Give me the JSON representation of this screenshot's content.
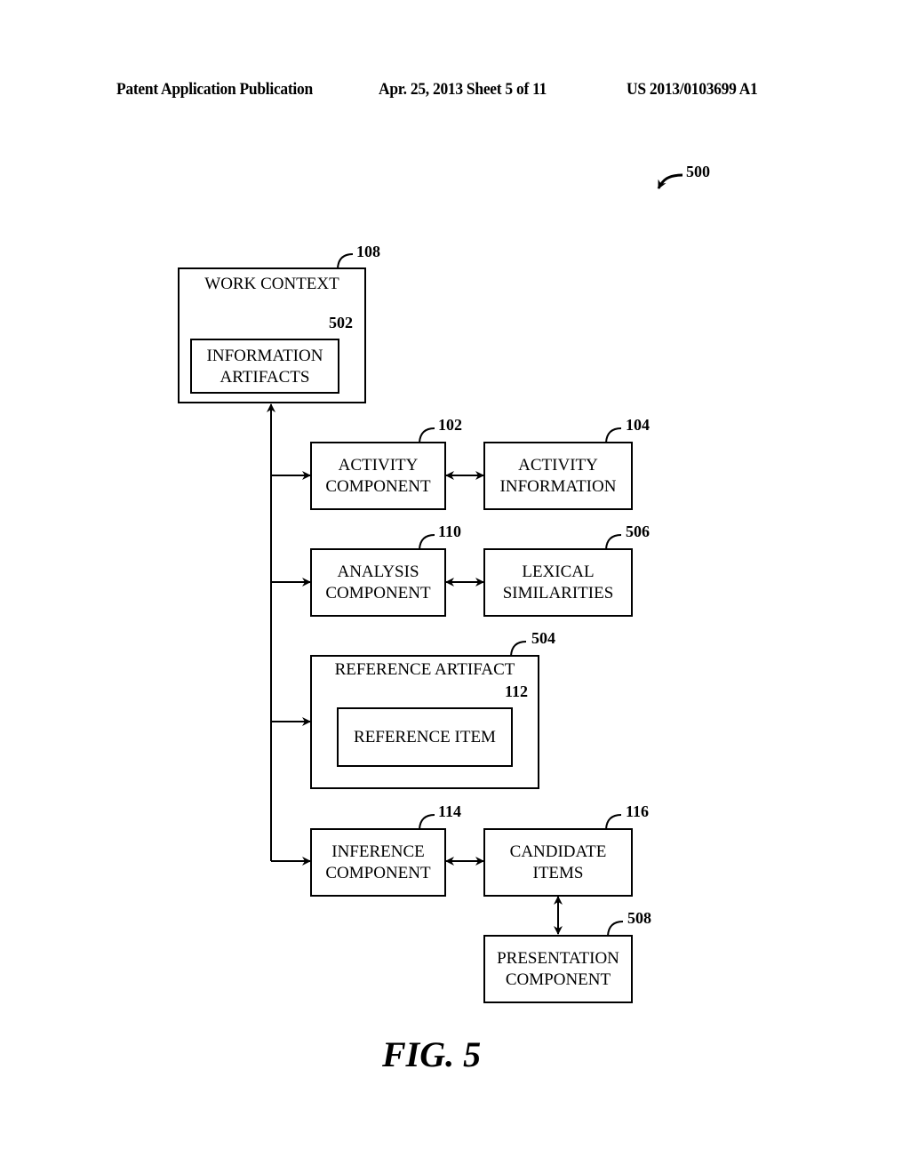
{
  "header": {
    "left": "Patent Application Publication",
    "middle": "Apr. 25, 2013  Sheet 5 of 11",
    "right": "US 2013/0103699 A1"
  },
  "figure_ref": "500",
  "figure_caption": "FIG. 5",
  "boxes": {
    "work_context": {
      "label": "WORK CONTEXT",
      "ref": "108"
    },
    "information_artifacts": {
      "line1": "INFORMATION",
      "line2": "ARTIFACTS",
      "ref": "502"
    },
    "activity_component": {
      "line1": "ACTIVITY",
      "line2": "COMPONENT",
      "ref": "102"
    },
    "activity_information": {
      "line1": "ACTIVITY",
      "line2": "INFORMATION",
      "ref": "104"
    },
    "analysis_component": {
      "line1": "ANALYSIS",
      "line2": "COMPONENT",
      "ref": "110"
    },
    "lexical_similarities": {
      "line1": "LEXICAL",
      "line2": "SIMILARITIES",
      "ref": "506"
    },
    "reference_artifact": {
      "label": "REFERENCE ARTIFACT",
      "ref": "504"
    },
    "reference_item": {
      "label": "REFERENCE ITEM",
      "ref": "112"
    },
    "inference_component": {
      "line1": "INFERENCE",
      "line2": "COMPONENT",
      "ref": "114"
    },
    "candidate_items": {
      "line1": "CANDIDATE",
      "line2": "ITEMS",
      "ref": "116"
    },
    "presentation_component": {
      "line1": "PRESENTATION",
      "line2": "COMPONENT",
      "ref": "508"
    }
  }
}
